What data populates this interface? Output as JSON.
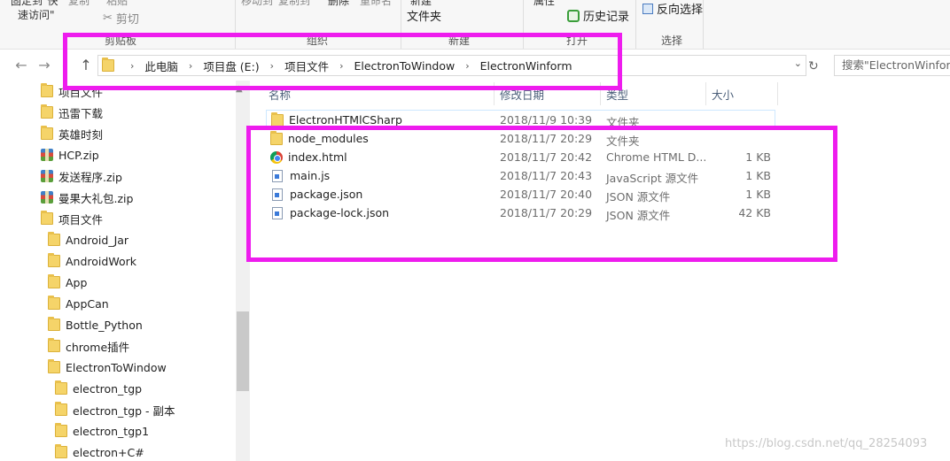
{
  "ribbon": {
    "cut_labels": [
      "固定到\"快",
      "复制",
      "粘贴",
      "移动到",
      "复制到",
      "删除",
      "重命名",
      "新建",
      "属性"
    ],
    "quick_access_line2": "速访问\"",
    "cut_label": "剪切",
    "new_folder_line": "文件夹",
    "history_label": "历史记录",
    "invert_select_label": "反向选择",
    "groups": [
      "剪贴板",
      "组织",
      "新建",
      "打开",
      "选择"
    ]
  },
  "nav": {
    "back_icon": "back-arrow-icon",
    "forward_icon": "forward-arrow-icon",
    "recent_icon": "chevron-down-icon",
    "up_icon": "up-arrow-icon",
    "breadcrumbs": [
      "此电脑",
      "项目盘 (E:)",
      "项目文件",
      "ElectronToWindow",
      "ElectronWinform"
    ],
    "search_placeholder": "搜索\"ElectronWinform\""
  },
  "tree": [
    {
      "label": "项目文件",
      "icon": "folder-icon"
    },
    {
      "label": "迅雷下载",
      "icon": "folder-icon"
    },
    {
      "label": "英雄时刻",
      "icon": "folder-icon"
    },
    {
      "label": "HCP.zip",
      "icon": "zip-icon"
    },
    {
      "label": "发送程序.zip",
      "icon": "zip-icon"
    },
    {
      "label": "曼果大礼包.zip",
      "icon": "zip-icon"
    },
    {
      "label": "项目文件",
      "icon": "folder-icon"
    },
    {
      "label": "Android_Jar",
      "icon": "folder-icon"
    },
    {
      "label": "AndroidWork",
      "icon": "folder-icon"
    },
    {
      "label": "App",
      "icon": "folder-icon"
    },
    {
      "label": "AppCan",
      "icon": "folder-icon"
    },
    {
      "label": "Bottle_Python",
      "icon": "folder-icon"
    },
    {
      "label": "chrome插件",
      "icon": "folder-icon"
    },
    {
      "label": "ElectronToWindow",
      "icon": "folder-icon"
    },
    {
      "label": "electron_tgp",
      "icon": "folder-icon"
    },
    {
      "label": "electron_tgp - 副本",
      "icon": "folder-icon"
    },
    {
      "label": "electron_tgp1",
      "icon": "folder-icon"
    },
    {
      "label": "electron+C#",
      "icon": "folder-icon"
    }
  ],
  "columns": [
    "名称",
    "修改日期",
    "类型",
    "大小"
  ],
  "files": [
    {
      "name": "ElectronHTMlCSharp",
      "date": "2018/11/9 10:39",
      "type": "文件夹",
      "size": "",
      "icon": "folder-icon"
    },
    {
      "name": "node_modules",
      "date": "2018/11/7 20:29",
      "type": "文件夹",
      "size": "",
      "icon": "folder-icon"
    },
    {
      "name": "index.html",
      "date": "2018/11/7 20:42",
      "type": "Chrome HTML D...",
      "size": "1 KB",
      "icon": "chrome-icon"
    },
    {
      "name": "main.js",
      "date": "2018/11/7 20:43",
      "type": "JavaScript 源文件",
      "size": "1 KB",
      "icon": "js-file-icon"
    },
    {
      "name": "package.json",
      "date": "2018/11/7 20:40",
      "type": "JSON 源文件",
      "size": "1 KB",
      "icon": "json-file-icon"
    },
    {
      "name": "package-lock.json",
      "date": "2018/11/7 20:29",
      "type": "JSON 源文件",
      "size": "42 KB",
      "icon": "json-file-icon"
    }
  ],
  "watermark": "https://blog.csdn.net/qq_28254093",
  "colors": {
    "highlight": "#ee1cee",
    "selection_border": "#cde8ff",
    "header_text": "#4c607a"
  }
}
